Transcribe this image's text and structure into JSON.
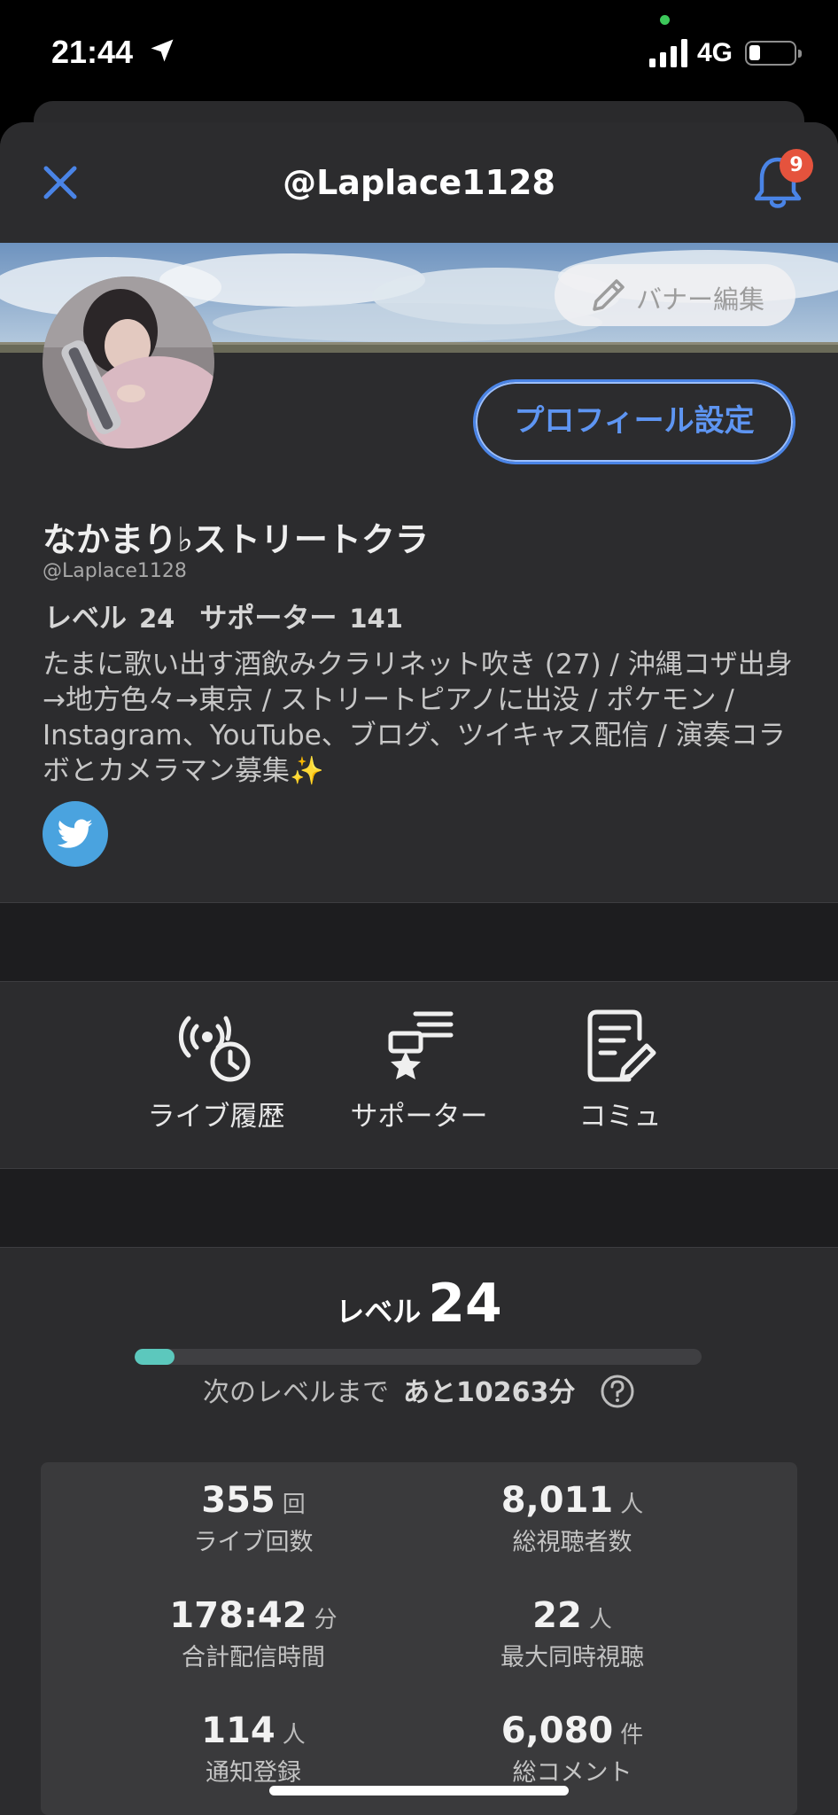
{
  "status_bar": {
    "time": "21:44",
    "network": "4G"
  },
  "header": {
    "title": "@Laplace1128",
    "notification_count": "9"
  },
  "banner": {
    "edit_label": "バナー編集"
  },
  "profile": {
    "settings_button": "プロフィール設定",
    "display_name": "なかまり♭ストリートクラ",
    "handle": "@Laplace1128",
    "level_label": "レベル",
    "level_value": "24",
    "supporter_label": "サポーター",
    "supporter_value": "141",
    "bio": "たまに歌い出す酒飲みクラリネット吹き (27) / 沖縄コザ出身→地方色々→東京 / ストリートピアノに出没 / ポケモン / Instagram、YouTube、ブログ、ツイキャス配信 / 演奏コラボとカメラマン募集✨"
  },
  "shortcuts": [
    {
      "label": "ライブ履歴",
      "icon": "live-history-icon"
    },
    {
      "label": "サポーター",
      "icon": "supporter-icon"
    },
    {
      "label": "コミュ",
      "icon": "community-icon"
    }
  ],
  "level_section": {
    "label": "レベル",
    "value": "24",
    "progress": 0.07,
    "next_level_label": "次のレベルまで",
    "next_level_value": "あと10263分"
  },
  "stats": [
    {
      "value": "355",
      "unit": "回",
      "label": "ライブ回数"
    },
    {
      "value": "8,011",
      "unit": "人",
      "label": "総視聴者数"
    },
    {
      "value": "178:42",
      "unit": "分",
      "label": "合計配信時間"
    },
    {
      "value": "22",
      "unit": "人",
      "label": "最大同時視聴"
    },
    {
      "value": "114",
      "unit": "人",
      "label": "通知登録"
    },
    {
      "value": "6,080",
      "unit": "件",
      "label": "総コメント"
    }
  ],
  "colors": {
    "accent": "#4a84e6",
    "progress": "#5cc8bd",
    "badge": "#e5533d",
    "twitter": "#4aa3df"
  }
}
